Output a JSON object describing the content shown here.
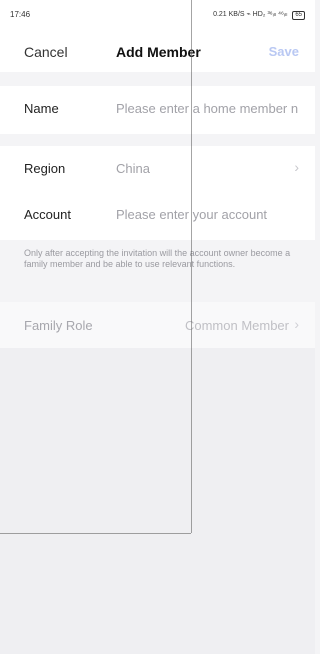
{
  "status": {
    "time": "17:46",
    "left_icons": "ⅡD ⅡI 60₈ ✱",
    "right_icons": "0.21 KB/S  ⌁ HD₂ ³⁶ᵢₗₗ ⁴⁶ᵢₗₗ",
    "battery": "65"
  },
  "nav": {
    "cancel": "Cancel",
    "title": "Add Member",
    "save": "Save"
  },
  "form": {
    "name_label": "Name",
    "name_placeholder": "Please enter a home member n",
    "region_label": "Region",
    "region_value": "China",
    "account_label": "Account",
    "account_placeholder": "Please enter your account",
    "note": "Only after accepting the invitation will the account owner become a family member and be able to use relevant functions.",
    "role_label": "Family Role",
    "role_value": "Common Member"
  },
  "icons": {
    "chevron": "chevron-right-icon"
  },
  "colors": {
    "save_disabled": "#b9c8f3",
    "background": "#f4f4f6"
  }
}
